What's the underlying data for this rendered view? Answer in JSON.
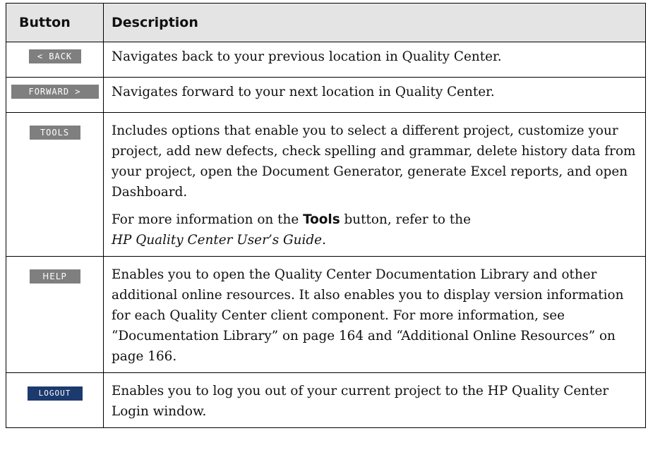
{
  "table": {
    "headers": {
      "button": "Button",
      "description": "Description"
    },
    "rows": [
      {
        "button_label": "< BACK",
        "description": "Navigates back to your previous location in Quality Center."
      },
      {
        "button_label": "FORWARD >",
        "description": "Navigates forward to your next location in Quality Center."
      },
      {
        "button_label": "TOOLS",
        "description": "Includes options that enable you to select a different project, customize your project, add new defects, check spelling and grammar, delete history data from your project, open the Document Generator, generate Excel reports, and open Dashboard.",
        "note_prefix": "For more information on the ",
        "note_bold": "Tools",
        "note_mid": " button, refer to the ",
        "note_italic": "HP Quality Center User’s Guide",
        "note_suffix": "."
      },
      {
        "button_label": "HELP",
        "description": "Enables you to open the Quality Center Documentation Library and other additional online resources. It also enables you to display version information for each Quality Center client component. For more information, see “Documentation Library” on page 164 and “Additional Online Resources” on page 166."
      },
      {
        "button_label": "LOGOUT",
        "description": "Enables you to log you out of your current project to the HP Quality Center Login window."
      }
    ]
  },
  "colors": {
    "header_bg": "#e4e4e4",
    "button_gray": "#7f7f7f",
    "logout_blue": "#1c3a6e"
  }
}
